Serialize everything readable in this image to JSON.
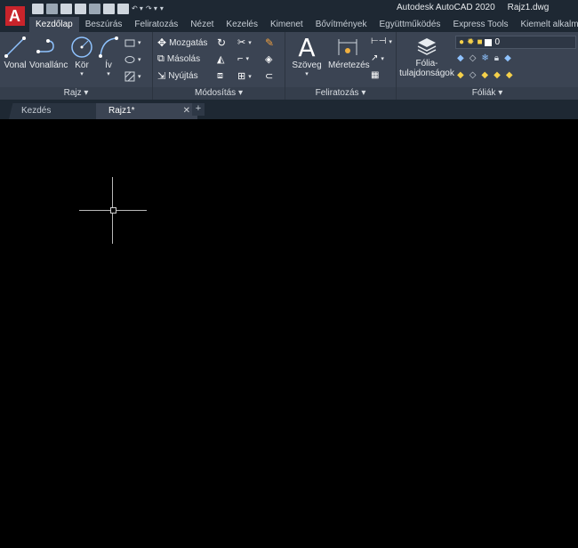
{
  "app": {
    "name": "Autodesk AutoCAD 2020",
    "document": "Rajz1.dwg",
    "logo_letter": "A",
    "accent_color": "#c8242b"
  },
  "ribbon_tabs": [
    "Kezdőlap",
    "Beszúrás",
    "Feliratozás",
    "Nézet",
    "Kezelés",
    "Kimenet",
    "Bővítmények",
    "Együttműködés",
    "Express Tools",
    "Kiemelt alkalmazások"
  ],
  "active_tab": "Kezdőlap",
  "panels": {
    "rajz": {
      "label": "Rajz ▾",
      "tools": [
        "Vonal",
        "Vonallánc",
        "Kör",
        "Ív"
      ]
    },
    "modositas": {
      "label": "Módosítás ▾",
      "tools": [
        "Mozgatás",
        "Másolás",
        "Nyújtás"
      ]
    },
    "feliratozas": {
      "label": "Feliratozás ▾",
      "tools": [
        "Szöveg",
        "Méretezés"
      ]
    },
    "foliak": {
      "label": "Fóliák ▾",
      "tool_line1": "Fólia-",
      "tool_line2": "tulajdonságok",
      "current_layer": "0"
    }
  },
  "file_tabs": {
    "start": "Kezdés",
    "active": "Rajz1*",
    "close": "✕",
    "new": "+"
  }
}
